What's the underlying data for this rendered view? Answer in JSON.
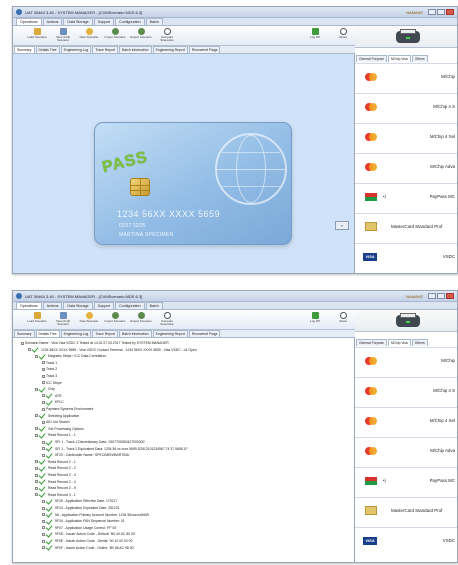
{
  "window": {
    "title": "UAT 30464 3.45 - SYSTEM MANAGER - [CVMScenario MDS 6.3]",
    "logo": "NAMAKE",
    "menu_tabs": [
      "Operations",
      "Actions",
      "Data Storage",
      "Support",
      "Configuration",
      "Batch"
    ],
    "ribbon": {
      "buttons": [
        {
          "label": "Load Scenario",
          "icon": "folder-icon"
        },
        {
          "label": "View (Full) Scenario",
          "icon": "document-icon"
        },
        {
          "label": "New Scenario",
          "icon": "new-star-icon"
        },
        {
          "label": "Import Scenario",
          "icon": "import-icon"
        },
        {
          "label": "Export Scenario",
          "icon": "export-icon"
        },
        {
          "label": "Compare Scenarios",
          "icon": "compare-icon"
        }
      ],
      "logout": "Log Off",
      "about": "About"
    },
    "sub_tabs": [
      "Summary",
      "Details Tree",
      "Engineering Log",
      "Trace Report",
      "Batch Information",
      "Engineering Report",
      "Recovered Flags"
    ]
  },
  "card": {
    "stamp": "PASS",
    "pan": "1234 56XX XXXX 5659",
    "expiry": "02/17  12/25",
    "holder": "MARTINA SPECIMEN"
  },
  "scroll_button": "»",
  "tree": {
    "nodes": [
      "Scenario Name : Visa Visa VSDC 3 Tested at 14:32 27.03.2017   Tested by SYSTEM MANAGER",
      "1234 56XX XXXX 5659 - Visa VSDC Contact Terminal - 1234 56XX XXXX 5659 - Visa VSDC - L8 Open",
      "Magnetic Stripe / ICC Data Correlation",
      "Track 1",
      "Track 2",
      "Track 3",
      "ICC Stripe",
      "Chip",
      "ATR",
      "EPLC",
      "Payment Systems Environment",
      "Selecting Application",
      "AID List Search",
      "Get Processing Options",
      "Read Record 1 - 1",
      "SFI 1 - Track 1 Discretionary Data: '0207700050427000000'",
      "SFI 1 - Track 2 Equivalent Data: 1234 56 xx xxxx 5659 D2512101234567 74 37 5658 1F",
      "5F20 - Cardholder Name: 'SPECIMEN/MARTINA'",
      "Read Record 2 - 1",
      "Read Record 2 - 2",
      "Read Record 2 - 3",
      "Read Record 2 - 4",
      "Read Record 2 - 5",
      "Read Record 3 - 1",
      "5F25 - Application Effective Date: 170217",
      "5F24 - Application Expiration Date: 251231",
      "5A - Application Primary Account Number: 1234 56xxxxxx5659",
      "5F34 - Application PAN Sequence Number: 01",
      "9F07 - Application Usage Control: 'FF 00'",
      "9F0D - Issuer Action Code - Default: 'B0 40 AC 80 00'",
      "9F0E - Issuer Action Code - Denial: '00 10 00 00 00'",
      "9F0F - Issuer Action Code - Online: 'B0 68 AC 98 00'"
    ]
  },
  "sidebar": {
    "tabs": [
      "General Purpose",
      "MChip Visa",
      "Others"
    ],
    "cards": [
      {
        "name": "M/Chip",
        "logo": "mastercard"
      },
      {
        "name": "M/Chip 4 S",
        "logo": "mastercard"
      },
      {
        "name": "M/Chip 4 Sel",
        "logo": "mastercard"
      },
      {
        "name": "M/Chip Adva",
        "logo": "mastercard"
      },
      {
        "name": "PayPass MC",
        "logo": "paypass",
        "extra": "•)"
      },
      {
        "name": "MasterCard Standard Prof",
        "logo": "folder"
      },
      {
        "name": "VSDC",
        "logo": "visa",
        "logo_text": "VISA"
      }
    ]
  },
  "colors": {
    "pass_stamp": "#7cc23a",
    "card_blue": "#93bde6",
    "check_green": "#2f9a2f",
    "mastercard_red": "#e53a2c",
    "mastercard_orange": "#f3a21c"
  }
}
